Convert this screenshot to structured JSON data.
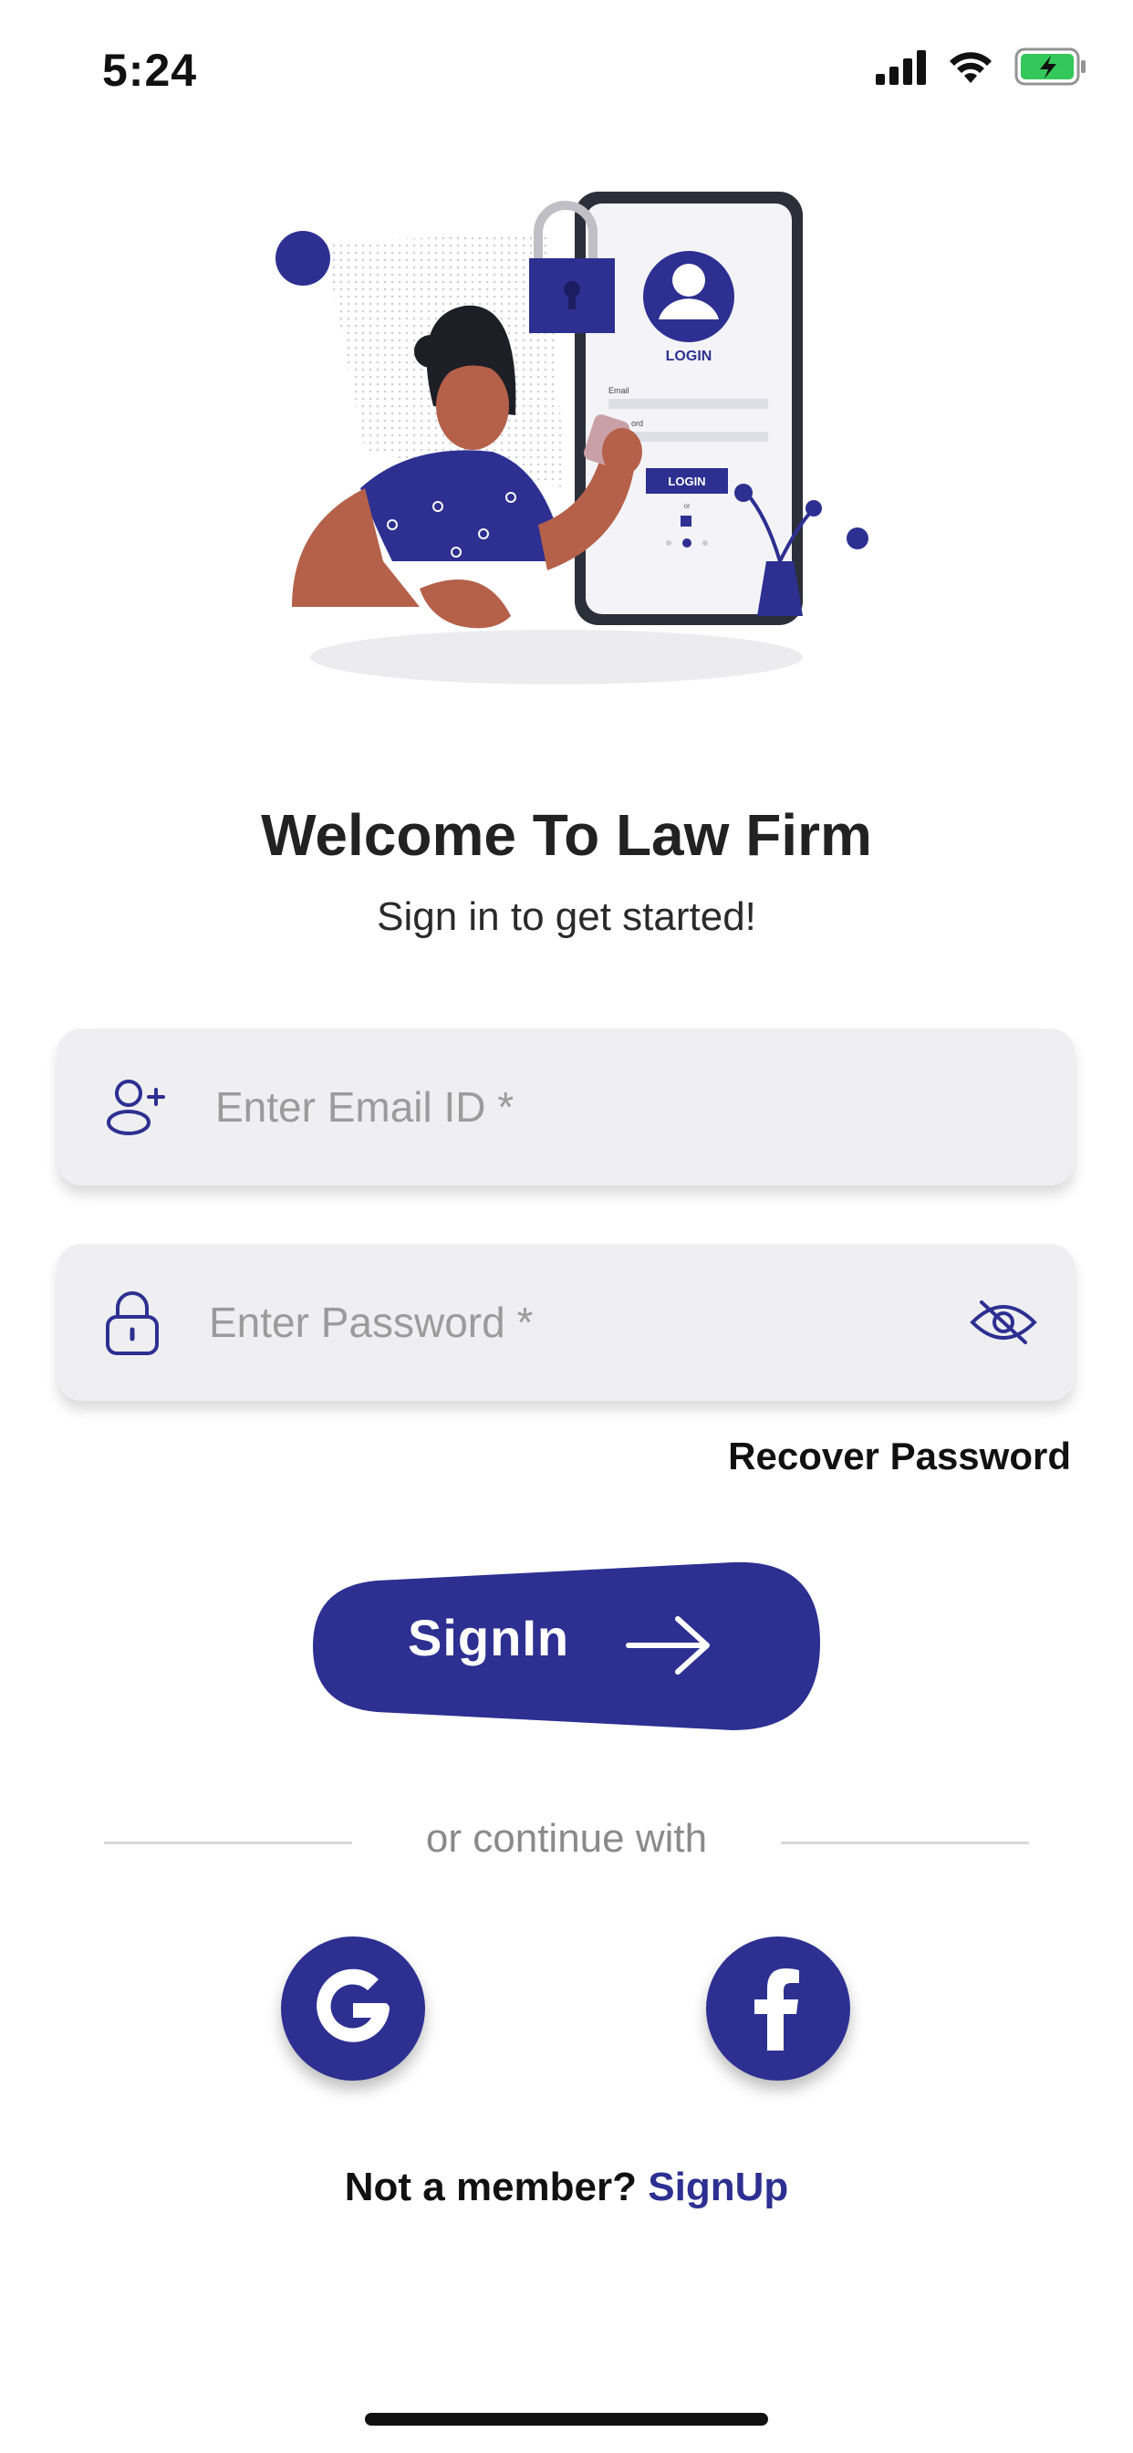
{
  "status_bar": {
    "time": "5:24",
    "battery_color": "#34c759"
  },
  "hero": {
    "phone_title": "LOGIN",
    "phone_email_label": "Email",
    "phone_password_label": "ord",
    "phone_button": "LOGIN",
    "phone_or": "or"
  },
  "title": "Welcome To Law Firm",
  "subtitle": "Sign in to get started!",
  "email_field": {
    "placeholder": "Enter Email ID *",
    "icon": "add-user-icon"
  },
  "password_field": {
    "placeholder": "Enter Password *",
    "icon": "lock-icon",
    "toggle_icon": "eye-off-icon"
  },
  "recover_password": "Recover Password",
  "signin_button": {
    "label": "SignIn",
    "icon": "arrow-right-icon"
  },
  "divider_text": "or continue with",
  "social": [
    {
      "name": "google",
      "icon": "google-icon"
    },
    {
      "name": "facebook",
      "icon": "facebook-icon"
    }
  ],
  "signup": {
    "prompt": "Not a member?",
    "link": "SignUp"
  },
  "colors": {
    "accent": "#2d3091",
    "field_bg": "#efeff1",
    "placeholder": "#9b9b9b",
    "divider": "#d9d9d9"
  }
}
